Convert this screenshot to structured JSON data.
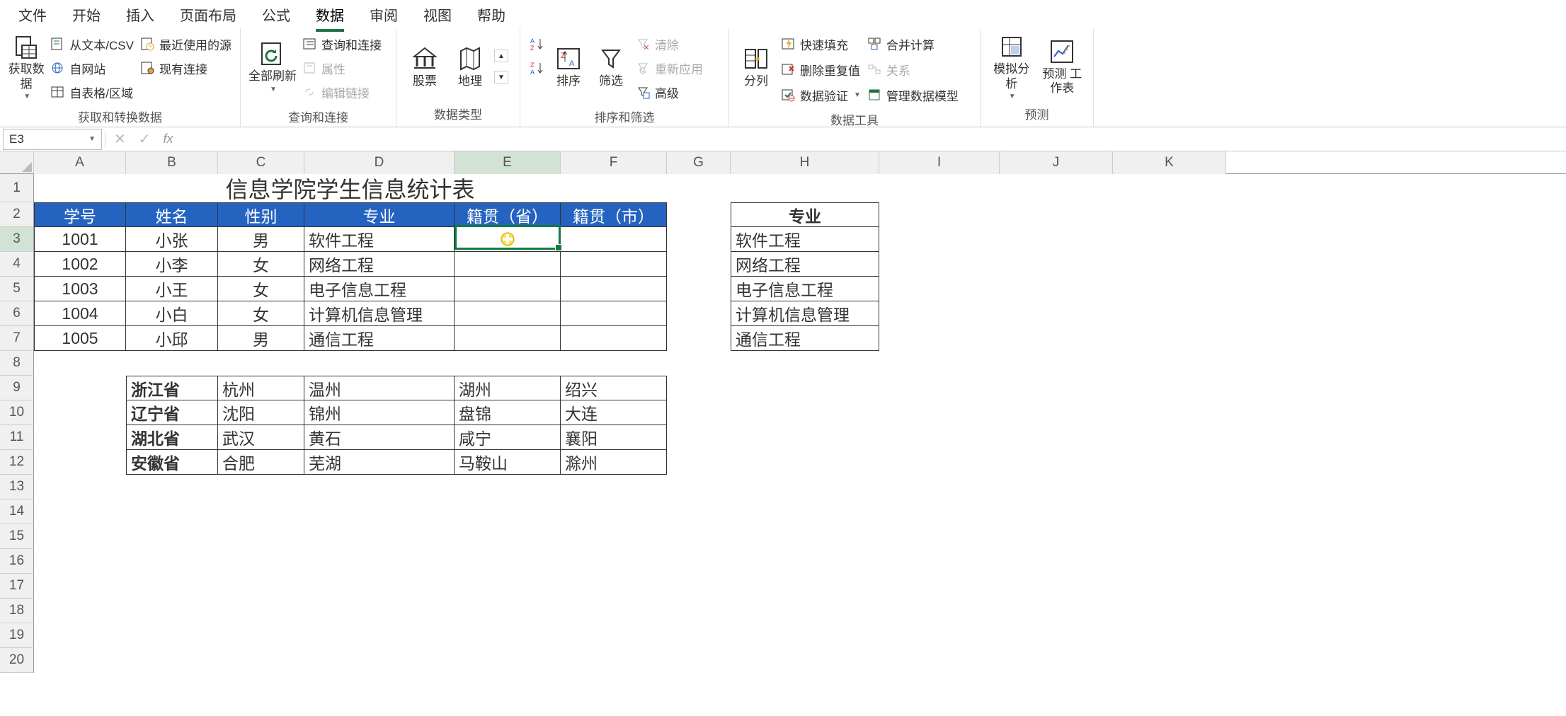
{
  "menu": {
    "tabs": [
      "文件",
      "开始",
      "插入",
      "页面布局",
      "公式",
      "数据",
      "审阅",
      "视图",
      "帮助"
    ],
    "active": 5
  },
  "ribbon": {
    "g1": {
      "label": "获取和转换数据",
      "getdata": "获取数\n据",
      "csv": "从文本/CSV",
      "recent": "最近使用的源",
      "web": "自网站",
      "existing": "现有连接",
      "table": "自表格/区域"
    },
    "g2": {
      "label": "查询和连接",
      "refresh": "全部刷新",
      "qc": "查询和连接",
      "prop": "属性",
      "editlink": "编辑链接"
    },
    "g3": {
      "label": "数据类型",
      "stock": "股票",
      "geo": "地理"
    },
    "g4": {
      "label": "排序和筛选",
      "az": "",
      "za": "",
      "sort": "排序",
      "filter": "筛选",
      "clear": "清除",
      "reapply": "重新应用",
      "adv": "高级"
    },
    "g5": {
      "label": "数据工具",
      "split": "分列",
      "flash": "快速填充",
      "dedup": "删除重复值",
      "valid": "数据验证",
      "consol": "合并计算",
      "rel": "关系",
      "model": "管理数据模型"
    },
    "g6": {
      "label": "预测",
      "whatif": "模拟分析",
      "forecast": "预测\n工作表"
    }
  },
  "namebox": "E3",
  "cols": [
    "A",
    "B",
    "C",
    "D",
    "E",
    "F",
    "G",
    "H",
    "I",
    "J",
    "K"
  ],
  "title": "信息学院学生信息统计表",
  "headers": [
    "学号",
    "姓名",
    "性别",
    "专业",
    "籍贯（省）",
    "籍贯（市）"
  ],
  "students": [
    {
      "id": "1001",
      "name": "小张",
      "sex": "男",
      "major": "软件工程"
    },
    {
      "id": "1002",
      "name": "小李",
      "sex": "女",
      "major": "网络工程"
    },
    {
      "id": "1003",
      "name": "小王",
      "sex": "女",
      "major": "电子信息工程"
    },
    {
      "id": "1004",
      "name": "小白",
      "sex": "女",
      "major": "计算机信息管理"
    },
    {
      "id": "1005",
      "name": "小邱",
      "sex": "男",
      "major": "通信工程"
    }
  ],
  "majors_hdr": "专业",
  "majors": [
    "软件工程",
    "网络工程",
    "电子信息工程",
    "计算机信息管理",
    "通信工程"
  ],
  "provinces": [
    {
      "name": "浙江省",
      "cities": [
        "杭州",
        "温州",
        "湖州",
        "绍兴"
      ]
    },
    {
      "name": "辽宁省",
      "cities": [
        "沈阳",
        "锦州",
        "盘锦",
        "大连"
      ]
    },
    {
      "name": "湖北省",
      "cities": [
        "武汉",
        "黄石",
        "咸宁",
        "襄阳"
      ]
    },
    {
      "name": "安徽省",
      "cities": [
        "合肥",
        "芜湖",
        "马鞍山",
        "滁州"
      ]
    }
  ]
}
